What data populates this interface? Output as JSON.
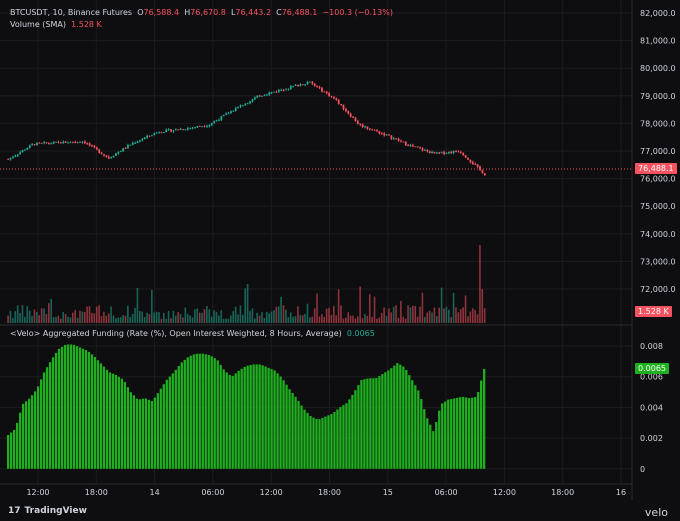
{
  "legend": {
    "symbol": "BTCUSDT, 10, Binance Futures",
    "open_label": "O",
    "open": "76,588.4",
    "high_label": "H",
    "high": "76,670.8",
    "low_label": "L",
    "low": "76,443.2",
    "close_label": "C",
    "close": "76,488.1",
    "change": "−100.3 (−0.13%)",
    "volume_label": "Volume (SMA)",
    "volume": "1.528 K",
    "indicator_label": "<Velo> Aggregated Funding (Rate (%), Open Interest Weighted, 8 Hours, Average)",
    "indicator_value": "0.0065"
  },
  "price_axis": {
    "ticks": [
      "82,000.0",
      "81,000.0",
      "80,000.0",
      "79,000.0",
      "78,000.0",
      "77,000.0",
      "76,000.0",
      "75,000.0",
      "74,000.0",
      "73,000.0",
      "72,000.0"
    ],
    "last_price_tag": "76,488.1",
    "volume_tag": "1.528 K"
  },
  "funding_axis": {
    "ticks": [
      "0.008",
      "0.006",
      "0.004",
      "0.002",
      "0"
    ],
    "value_tag": "0.0065"
  },
  "time_axis": {
    "ticks": [
      "12:00",
      "18:00",
      "14",
      "06:00",
      "12:00",
      "18:00",
      "15",
      "06:00",
      "12:00",
      "18:00",
      "16"
    ]
  },
  "footer": {
    "brand": "TradingView",
    "brand_logo": "17",
    "watermark": "velo"
  },
  "colors": {
    "background": "#0e0e10",
    "up": "#22ab94",
    "down": "#f7525f",
    "funding": "#1fb01f",
    "grid": "#1c1c1f"
  },
  "chart_data": [
    {
      "type": "line",
      "name": "BTCUSDT price (approx. close)",
      "x": [
        "13 10:00",
        "13 12:00",
        "13 15:00",
        "13 18:00",
        "13 20:00",
        "14 00:00",
        "14 03:00",
        "14 06:00",
        "14 09:00",
        "14 12:00",
        "14 14:00",
        "14 16:00",
        "14 17:00",
        "14 20:00",
        "15 00:00",
        "15 03:00",
        "15 05:00",
        "15 07:00",
        "15 09:00",
        "15 09:30"
      ],
      "values": [
        76700,
        77250,
        77300,
        77350,
        76750,
        77300,
        77700,
        77800,
        77950,
        78500,
        79000,
        79250,
        79500,
        78900,
        77950,
        77600,
        77200,
        76900,
        77000,
        76150
      ],
      "ylim": [
        71500,
        82200
      ]
    },
    {
      "type": "bar",
      "name": "Aggregated Funding Rate (%)",
      "x_range": [
        "13 08:00",
        "15 09:30"
      ],
      "values": [
        0.0022,
        0.0026,
        0.0042,
        0.0046,
        0.0052,
        0.0063,
        0.0071,
        0.0078,
        0.0081,
        0.0081,
        0.0079,
        0.0077,
        0.0073,
        0.0068,
        0.0063,
        0.0061,
        0.0058,
        0.005,
        0.0045,
        0.0046,
        0.0044,
        0.0051,
        0.0058,
        0.0063,
        0.0069,
        0.0073,
        0.0075,
        0.0075,
        0.0074,
        0.0071,
        0.0064,
        0.006,
        0.0064,
        0.0067,
        0.0068,
        0.0068,
        0.0066,
        0.0064,
        0.0059,
        0.0052,
        0.0046,
        0.0039,
        0.0034,
        0.0032,
        0.0034,
        0.0036,
        0.004,
        0.0043,
        0.005,
        0.0058,
        0.0059,
        0.0059,
        0.0062,
        0.0065,
        0.0069,
        0.0066,
        0.0058,
        0.005,
        0.0034,
        0.0024,
        0.0042,
        0.0045,
        0.0046,
        0.0047,
        0.0046,
        0.0047,
        0.0065
      ],
      "ylim": [
        0,
        0.0085
      ]
    }
  ]
}
